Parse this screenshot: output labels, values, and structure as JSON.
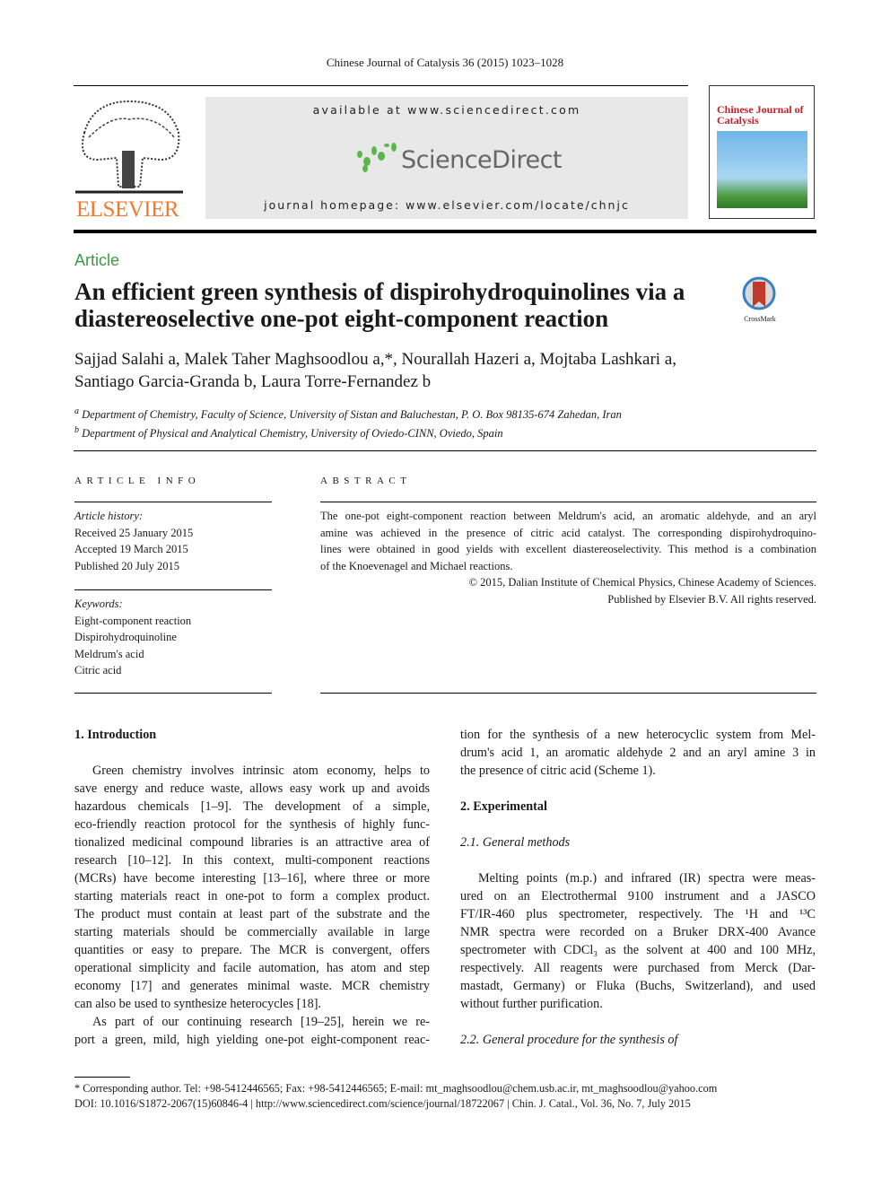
{
  "header": {
    "journal_ref": "Chinese Journal of Catalysis 36 (2015) 1023–1028",
    "available": "available at www.sciencedirect.com",
    "sciencedirect_logo": "ScienceDirect",
    "homepage": "journal homepage: www.elsevier.com/locate/chnjc",
    "publisher_logo": "ELSEVIER",
    "cover_title": "Chinese Journal of Catalysis",
    "accent_green": "#3c9a46",
    "elsevier_orange": "#f07b2f"
  },
  "article": {
    "type": "Article",
    "title_line1": "An efficient green synthesis of dispirohydroquinolines via a",
    "title_line2": "diastereoselective one-pot eight-component reaction",
    "crossmark": "CrossMark",
    "authors_line1": "Sajjad Salahi a, Malek Taher Maghsoodlou a,*, Nourallah Hazeri a, Mojtaba Lashkari a,",
    "authors_line2": "Santiago Garcia-Granda b, Laura Torre-Fernandez b",
    "aff_a": "Department of Chemistry, Faculty of Science, University of Sistan and Baluchestan, P. O. Box 98135-674 Zahedan, Iran",
    "aff_b": "Department of Physical and Analytical Chemistry, University of Oviedo-CINN, Oviedo, Spain"
  },
  "info": {
    "heading": "ARTICLE INFO",
    "history_label": "Article history:",
    "history": [
      "Received 25 January 2015",
      "Accepted 19 March 2015",
      "Published 20 July 2015"
    ],
    "keywords_label": "Keywords:",
    "keywords": [
      "Eight-component reaction",
      "Dispirohydroquinoline",
      "Meldrum's acid",
      "Citric acid"
    ]
  },
  "abstract": {
    "heading": "ABSTRACT",
    "lines": [
      "The one-pot eight-component reaction between Meldrum's acid, an aromatic aldehyde, and an aryl",
      "amine was achieved in the presence of citric acid catalyst. The corresponding dispirohydroquino-",
      "lines were obtained in good yields with excellent diastereoselectivity. This method is a combination",
      "of the Knoevenagel and Michael reactions."
    ],
    "copyright1": "© 2015, Dalian Institute of Chemical Physics, Chinese Academy of Sciences.",
    "copyright2": "Published by Elsevier B.V. All rights reserved."
  },
  "body_left": [
    {
      "t": "1.    Introduction",
      "c": "head"
    },
    {
      "t": "",
      "c": "last"
    },
    {
      "t": "Green chemistry involves intrinsic atom economy, helps to",
      "c": "ind"
    },
    {
      "t": "save energy and reduce waste, allows easy work up and avoids"
    },
    {
      "t": "hazardous chemicals [1–9]. The development of a simple,"
    },
    {
      "t": "eco-friendly reaction protocol for the synthesis of highly func-"
    },
    {
      "t": "tionalized medicinal compound libraries is an attractive area of"
    },
    {
      "t": "research [10–12]. In this context, multi-component reactions"
    },
    {
      "t": "(MCRs) have become interesting [13–16], where three or more"
    },
    {
      "t": "starting materials react in one-pot to form a complex product."
    },
    {
      "t": "The product must contain at least part of the substrate and the"
    },
    {
      "t": "starting materials should be commercially available in large"
    },
    {
      "t": "quantities or easy to prepare. The MCR is convergent, offers"
    },
    {
      "t": "operational simplicity and facile automation, has atom and step"
    },
    {
      "t": "economy [17] and generates minimal waste. MCR chemistry"
    },
    {
      "t": "can also be used to synthesize heterocycles [18].",
      "c": "last"
    },
    {
      "t": "As part of our continuing research [19–25], herein we re-",
      "c": "ind"
    },
    {
      "t": "port a green, mild, high yielding one-pot eight-component reac-"
    }
  ],
  "body_right": [
    {
      "t": "tion for the synthesis of a new heterocyclic system from Mel-"
    },
    {
      "t": "drum's acid 1, an aromatic aldehyde 2 and an aryl amine 3 in"
    },
    {
      "t": "the presence of citric acid (Scheme 1).",
      "c": "last"
    },
    {
      "t": "",
      "c": "last"
    },
    {
      "t": "2.    Experimental",
      "c": "head"
    },
    {
      "t": "",
      "c": "last"
    },
    {
      "t": "2.1.    General methods",
      "c": "sub"
    },
    {
      "t": "",
      "c": "last"
    },
    {
      "t": "Melting points (m.p.) and infrared (IR) spectra were meas-",
      "c": "ind"
    },
    {
      "t": "ured on an Electrothermal 9100 instrument and a JASCO"
    },
    {
      "t": "FT/IR-460 plus spectrometer, respectively. The ¹H and ¹³C"
    },
    {
      "t": "NMR spectra were recorded on a Bruker DRX-400 Avance"
    },
    {
      "t": "spectrometer with CDCl₃ as the solvent at 400 and 100 MHz,"
    },
    {
      "t": "respectively. All reagents were purchased from Merck (Dar-"
    },
    {
      "t": "mastadt, Germany) or Fluka (Buchs, Switzerland), and used"
    },
    {
      "t": "without further purification.",
      "c": "last"
    },
    {
      "t": "",
      "c": "last"
    },
    {
      "t": "2.2.    General procedure for the synthesis of",
      "c": "sub"
    }
  ],
  "footnote": {
    "corresponding": "* Corresponding author. Tel: +98-5412446565; Fax: +98-5412446565; E-mail: mt_maghsoodlou@chem.usb.ac.ir, mt_maghsoodlou@yahoo.com",
    "doi": "DOI: 10.1016/S1872-2067(15)60846-4 | http://www.sciencedirect.com/science/journal/18722067 | Chin. J. Catal., Vol. 36, No. 7, July 2015"
  }
}
